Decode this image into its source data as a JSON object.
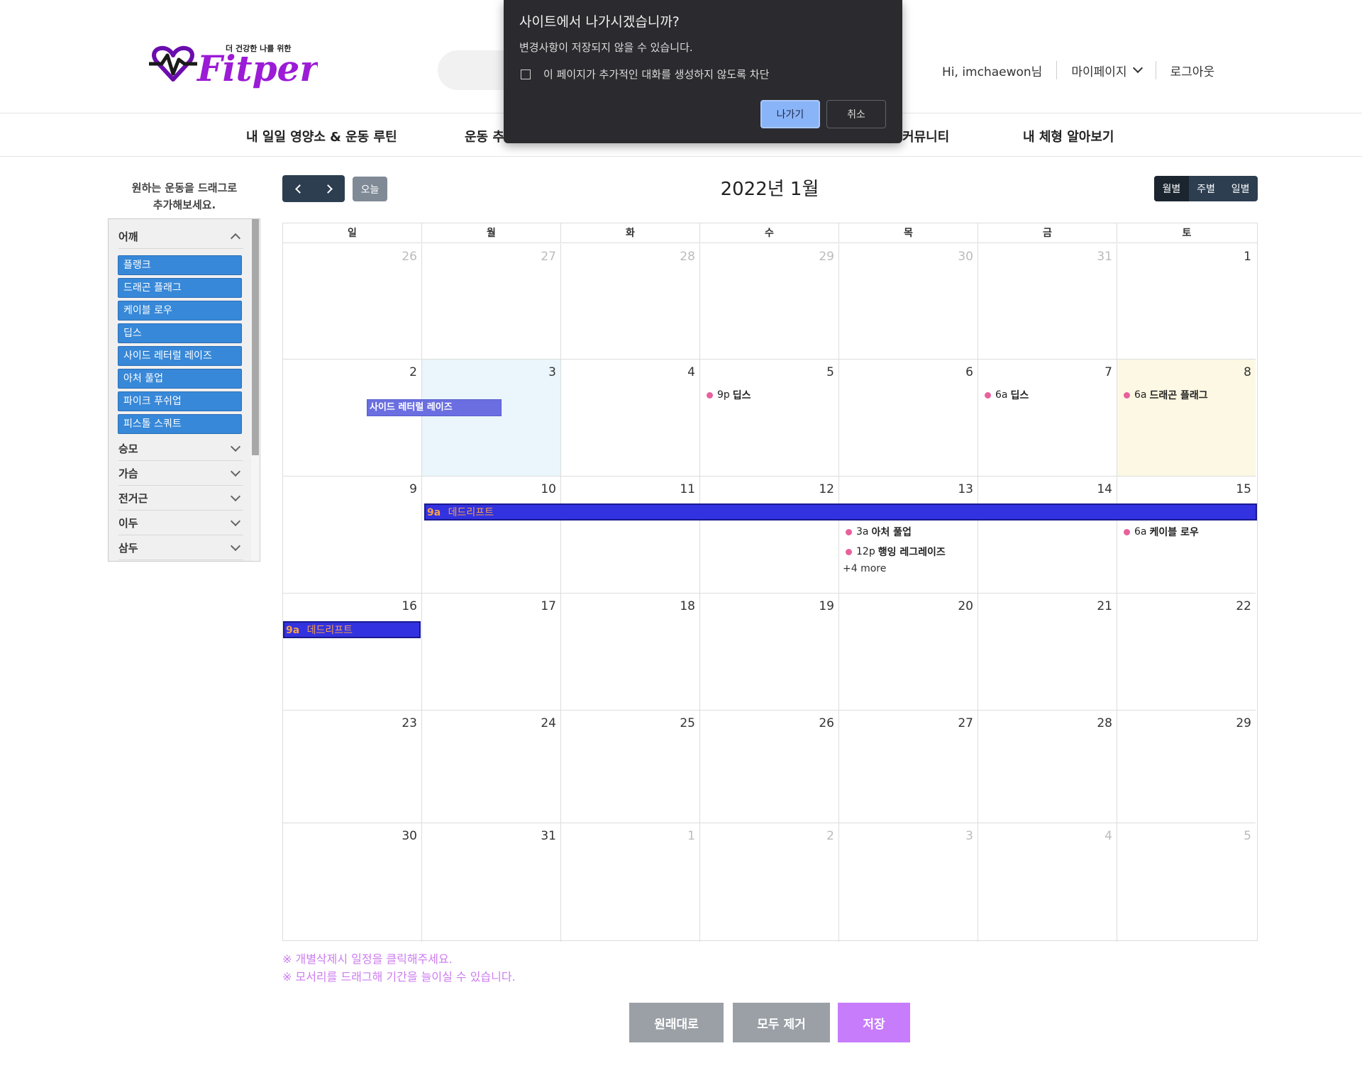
{
  "header": {
    "logo_tagline": "더 건강한 나를 위한",
    "logo_text": "Fitper",
    "greeting": "Hi, imchaewon님",
    "mypage": "마이페이지",
    "logout": "로그아웃"
  },
  "nav": {
    "items": [
      "내 일일 영양소 & 운동 루틴",
      "운동 추",
      "커뮤니티",
      "내 체형 알아보기"
    ]
  },
  "dialog": {
    "title": "사이트에서 나가시겠습니까?",
    "message": "변경사항이 저장되지 않을 수 있습니다.",
    "checkbox_label": "이 페이지가 추가적인 대화를 생성하지 않도록 차단",
    "leave": "나가기",
    "cancel": "취소"
  },
  "sidebar": {
    "hint_line1": "원하는 운동을 드래그로",
    "hint_line2": "추가해보세요.",
    "categories": [
      {
        "label": "어깨",
        "expanded": true,
        "items": [
          "플랭크",
          "드래곤 플래그",
          "케이블 로우",
          "딥스",
          "사이드 레터럴 레이즈",
          "아처 풀업",
          "파이크 푸쉬업",
          "피스톨 스쿼트"
        ]
      },
      {
        "label": "승모",
        "expanded": false,
        "items": []
      },
      {
        "label": "가슴",
        "expanded": false,
        "items": []
      },
      {
        "label": "전거근",
        "expanded": false,
        "items": []
      },
      {
        "label": "이두",
        "expanded": false,
        "items": []
      },
      {
        "label": "삼두",
        "expanded": false,
        "items": []
      }
    ]
  },
  "calendar": {
    "today_label": "오늘",
    "title": "2022년 1월",
    "views": [
      "월별",
      "주별",
      "일별"
    ],
    "active_view": "월별",
    "weekdays": [
      "일",
      "월",
      "화",
      "수",
      "목",
      "금",
      "토"
    ],
    "weeks": [
      [
        {
          "d": "26",
          "o": true
        },
        {
          "d": "27",
          "o": true
        },
        {
          "d": "28",
          "o": true
        },
        {
          "d": "29",
          "o": true
        },
        {
          "d": "30",
          "o": true
        },
        {
          "d": "31",
          "o": true
        },
        {
          "d": "1"
        }
      ],
      [
        {
          "d": "2"
        },
        {
          "d": "3",
          "s": true
        },
        {
          "d": "4"
        },
        {
          "d": "5"
        },
        {
          "d": "6"
        },
        {
          "d": "7"
        },
        {
          "d": "8",
          "t": true
        }
      ],
      [
        {
          "d": "9"
        },
        {
          "d": "10"
        },
        {
          "d": "11"
        },
        {
          "d": "12"
        },
        {
          "d": "13"
        },
        {
          "d": "14"
        },
        {
          "d": "15"
        }
      ],
      [
        {
          "d": "16"
        },
        {
          "d": "17"
        },
        {
          "d": "18"
        },
        {
          "d": "19"
        },
        {
          "d": "20"
        },
        {
          "d": "21"
        },
        {
          "d": "22"
        }
      ],
      [
        {
          "d": "23"
        },
        {
          "d": "24"
        },
        {
          "d": "25"
        },
        {
          "d": "26"
        },
        {
          "d": "27"
        },
        {
          "d": "28"
        },
        {
          "d": "29"
        }
      ],
      [
        {
          "d": "30"
        },
        {
          "d": "31"
        },
        {
          "d": "1",
          "o": true
        },
        {
          "d": "2",
          "o": true
        },
        {
          "d": "3",
          "o": true
        },
        {
          "d": "4",
          "o": true
        },
        {
          "d": "5",
          "o": true
        }
      ]
    ],
    "events": {
      "side_lateral": "사이드 레터럴 레이즈",
      "dips_5": {
        "time": "9p",
        "name": "딥스"
      },
      "dips_7": {
        "time": "6a",
        "name": "딥스"
      },
      "dragon_8": {
        "time": "6a",
        "name": "드래곤 플래그"
      },
      "deadlift_w3": {
        "time": "9a",
        "name": "데드리프트"
      },
      "archer_13": {
        "time": "3a",
        "name": "아처 풀업"
      },
      "hanging_13": {
        "time": "12p",
        "name": "행잉 레그레이즈"
      },
      "more_13": "+4 more",
      "cable_15": {
        "time": "6a",
        "name": "케이블 로우"
      },
      "deadlift_w4": {
        "time": "9a",
        "name": "데드리프트"
      }
    }
  },
  "notes": {
    "line1": "※ 개별삭제시 일정을 클릭해주세요.",
    "line2": "※ 모서리를 드래그해 기간을 늘이실 수 있습니다."
  },
  "actions": {
    "reset": "원래대로",
    "clear": "모두 제거",
    "save": "저장"
  },
  "colors": {
    "accent_violet": "#c77cfb",
    "event_dot": "#e8609c",
    "today_bg": "#fcf8e3",
    "toolbar_dark": "#2c3e50"
  }
}
